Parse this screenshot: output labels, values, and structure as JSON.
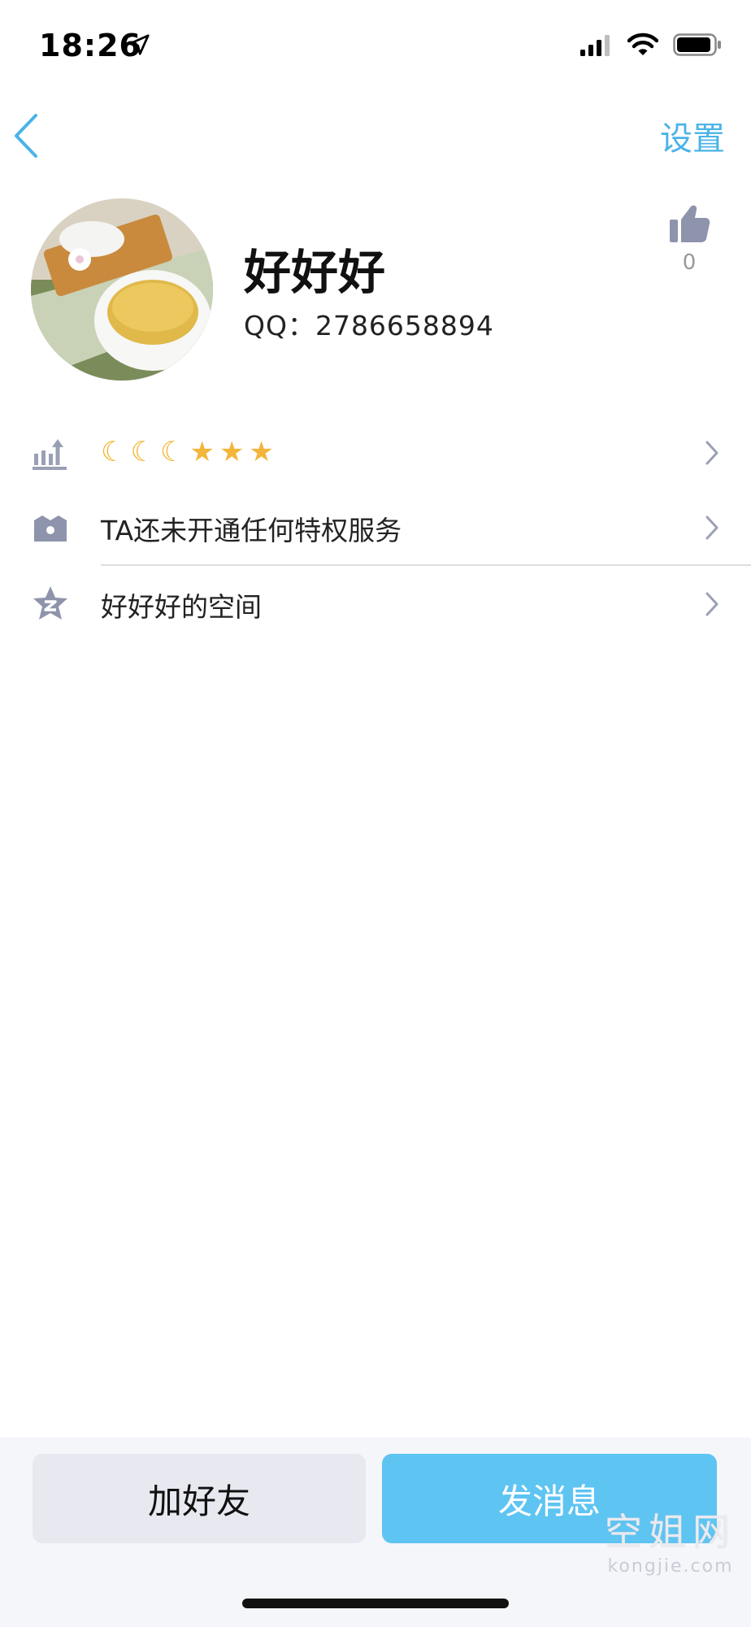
{
  "status_bar": {
    "time": "18:26",
    "icons": [
      "location-arrow-icon",
      "signal-icon",
      "wifi-icon",
      "battery-icon"
    ]
  },
  "nav": {
    "back_icon": "chevron-left-icon",
    "settings_label": "设置"
  },
  "profile": {
    "name": "好好好",
    "qq": "QQ：2786658894",
    "like_count": "0"
  },
  "rows": [
    {
      "icon": "level-icon",
      "label": "",
      "level_icons": [
        "moon",
        "moon",
        "moon",
        "star",
        "star",
        "star"
      ]
    },
    {
      "icon": "crown-icon",
      "label": "TA还未开通任何特权服务"
    },
    {
      "icon": "qzone-star-icon",
      "label": "好好好的空间"
    }
  ],
  "actions": {
    "add_friend": "加好友",
    "send_message": "发消息"
  },
  "watermark": {
    "main": "空姐网",
    "sub": "kongjie.com"
  },
  "colors": {
    "accent": "#4bb3e8",
    "primary_button": "#5ec4f2",
    "secondary_button": "#e8e9f0",
    "icon_gray": "#9aa0b4"
  }
}
